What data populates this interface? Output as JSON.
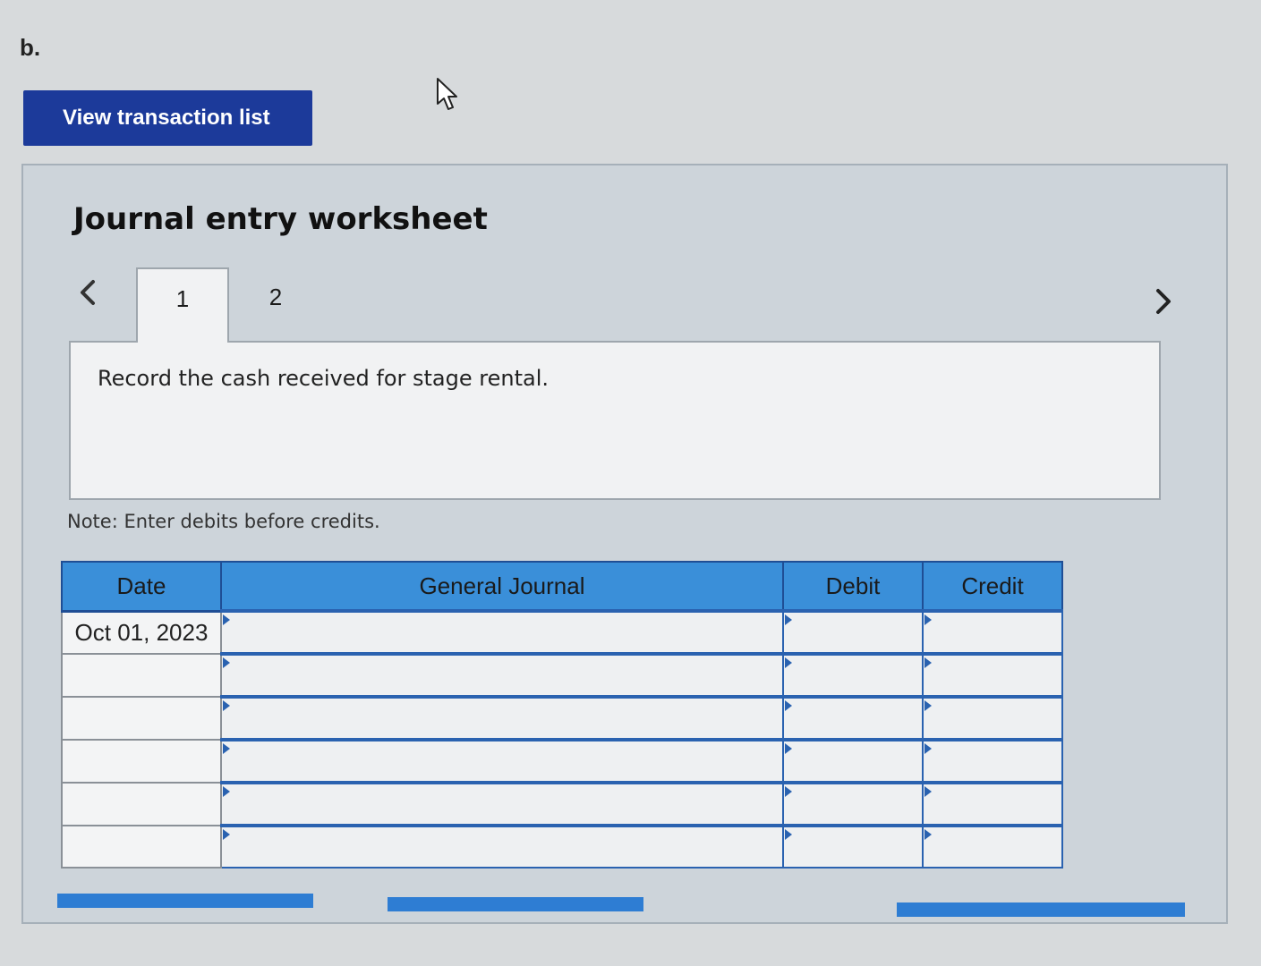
{
  "part_label": "b.",
  "view_button_label": "View transaction list",
  "worksheet": {
    "title": "Journal entry worksheet",
    "tabs": [
      {
        "label": "1",
        "active": true
      },
      {
        "label": "2",
        "active": false
      }
    ],
    "prompt": "Record the cash received for stage rental.",
    "note": "Note: Enter debits before credits."
  },
  "journal": {
    "headers": {
      "date": "Date",
      "general_journal": "General Journal",
      "debit": "Debit",
      "credit": "Credit"
    },
    "rows": [
      {
        "date": "Oct 01, 2023",
        "account": "",
        "debit": "",
        "credit": ""
      },
      {
        "date": "",
        "account": "",
        "debit": "",
        "credit": ""
      },
      {
        "date": "",
        "account": "",
        "debit": "",
        "credit": ""
      },
      {
        "date": "",
        "account": "",
        "debit": "",
        "credit": ""
      },
      {
        "date": "",
        "account": "",
        "debit": "",
        "credit": ""
      },
      {
        "date": "",
        "account": "",
        "debit": "",
        "credit": ""
      }
    ]
  },
  "colors": {
    "primary_button": "#1c3a9a",
    "table_header": "#3a8fd9",
    "table_border": "#2a62b0"
  },
  "icons": {
    "cursor": "mouse-pointer-icon",
    "prev": "chevron-left-icon",
    "next": "chevron-right-icon"
  }
}
